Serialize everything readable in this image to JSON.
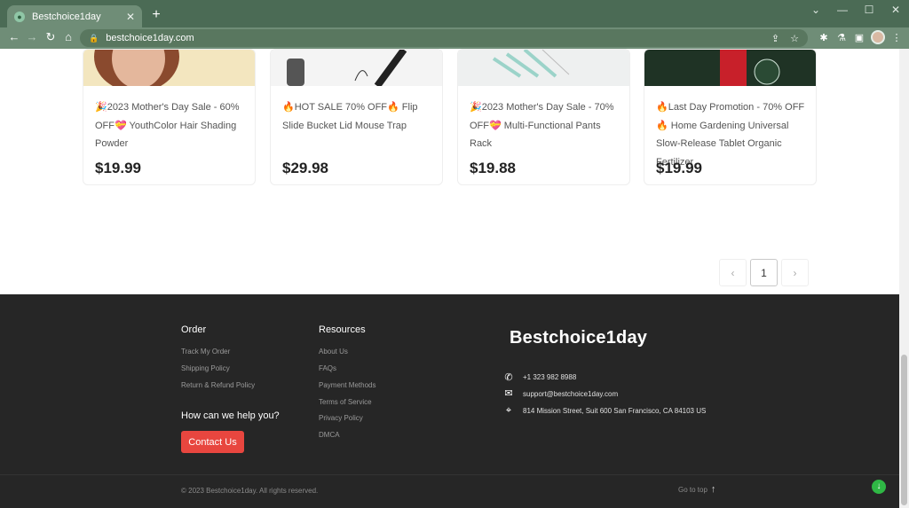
{
  "browser": {
    "tab_title": "Bestchoice1day",
    "tab_close": "✕",
    "new_tab": "+",
    "url": "bestchoice1day.com",
    "window_controls": [
      "⌄",
      "—",
      "☐",
      "✕"
    ],
    "nav": {
      "back": "←",
      "forward": "→",
      "reload": "↻",
      "home": "⌂"
    }
  },
  "products": [
    {
      "title": "🎉2023 Mother's Day Sale - 60% OFF💝 YouthColor Hair Shading Powder",
      "price": "$19.99",
      "image_color": "#f3e6bf",
      "image_name": "hair-product-image"
    },
    {
      "title": "🔥HOT SALE 70% OFF🔥 Flip Slide Bucket Lid Mouse Trap",
      "price": "$29.98",
      "image_color": "#f4f4f4",
      "image_name": "mouse-trap-image"
    },
    {
      "title": "🎉2023 Mother's Day Sale - 70% OFF💝 Multi-Functional Pants Rack",
      "price": "$19.88",
      "image_color": "#eef0f0",
      "image_name": "pants-rack-image"
    },
    {
      "title": "🔥Last Day Promotion - 70% OFF🔥 Home Gardening Universal Slow-Release Tablet Organic Fertilizer",
      "price": "$19.99",
      "image_color": "#1f3325",
      "image_name": "fertilizer-image"
    }
  ],
  "pagination": {
    "prev": "‹",
    "current": "1",
    "next": "›"
  },
  "footer": {
    "order": {
      "title": "Order",
      "links": [
        "Track My Order",
        "Shipping Policy",
        "Return & Refund Policy"
      ]
    },
    "resources": {
      "title": "Resources",
      "links": [
        "About Us",
        "FAQs",
        "Payment Methods",
        "Terms of Service",
        "Privacy Policy",
        "DMCA"
      ]
    },
    "help_title": "How can we help you?",
    "contact_button": "Contact Us",
    "brand": "Bestchoice1day",
    "contacts": {
      "phone": "+1 323 982 8988",
      "email": "support@bestchoice1day.com",
      "address": "814 Mission Street, Suit 600 San Francisco, CA 84103 US"
    },
    "copyright": "© 2023 Bestchoice1day. All rights reserved.",
    "go_to_top": "Go to top"
  },
  "colors": {
    "chrome": "#4b6b55",
    "footer": "#262626",
    "contact_button": "#e8463f"
  }
}
